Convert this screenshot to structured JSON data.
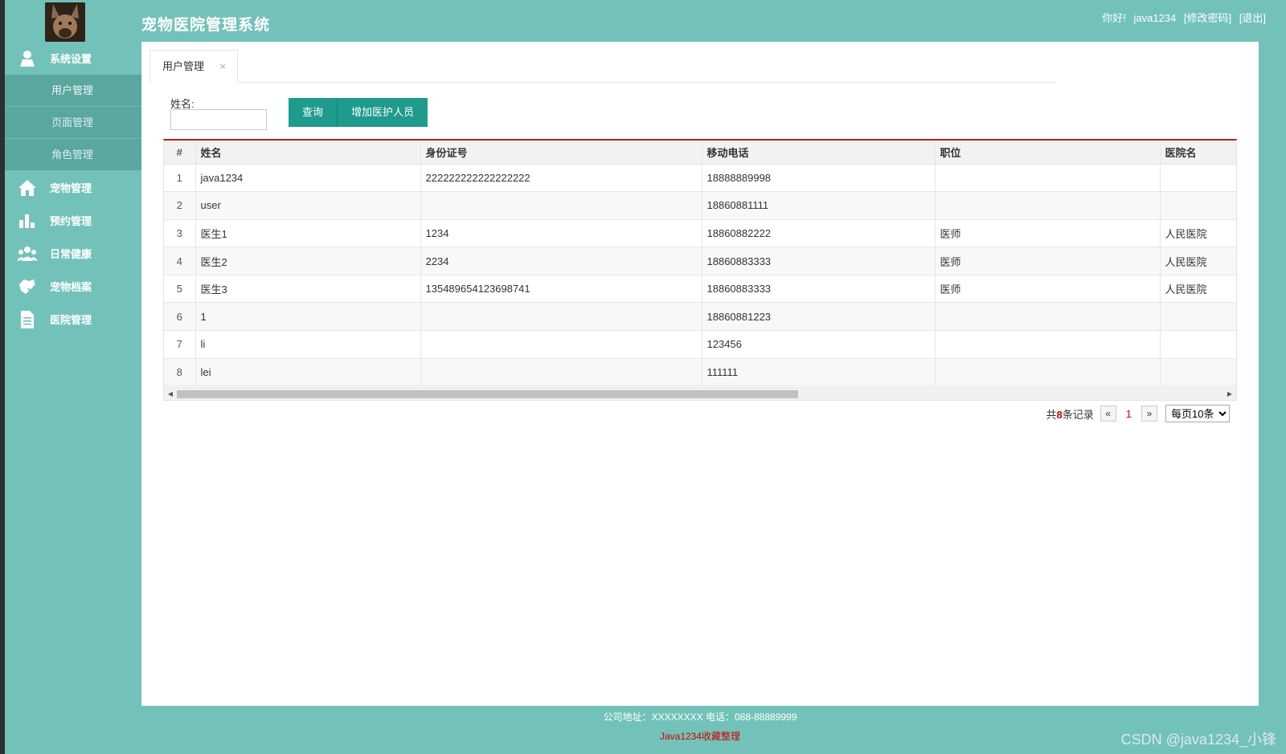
{
  "app": {
    "title": "宠物医院管理系统",
    "greeting": "你好!",
    "username": "java1234",
    "change_password": "[修改密码]",
    "logout": "[退出]"
  },
  "sidebar": {
    "sections": [
      {
        "label": "系统设置",
        "icon": "user-icon"
      },
      {
        "label": "宠物管理",
        "icon": "home-icon"
      },
      {
        "label": "预约管理",
        "icon": "bar-chart-icon"
      },
      {
        "label": "日常健康",
        "icon": "group-icon"
      },
      {
        "label": "宠物档案",
        "icon": "pet-record-icon"
      },
      {
        "label": "医院管理",
        "icon": "document-icon"
      }
    ],
    "sub_items": [
      "用户管理",
      "页面管理",
      "角色管理"
    ]
  },
  "tabs": [
    {
      "label": "用户管理",
      "close": "×"
    }
  ],
  "search": {
    "label": "姓名:",
    "value": "",
    "placeholder": ""
  },
  "buttons": {
    "query": "查询",
    "add": "增加医护人员"
  },
  "table": {
    "headers": [
      "#",
      "姓名",
      "身份证号",
      "移动电话",
      "职位",
      "医院名"
    ],
    "rows": [
      [
        "1",
        "java1234",
        "222222222222222222",
        "18888889998",
        "",
        ""
      ],
      [
        "2",
        "user",
        "",
        "18860881111",
        "",
        ""
      ],
      [
        "3",
        "医生1",
        "1234",
        "18860882222",
        "医师",
        "人民医院"
      ],
      [
        "4",
        "医生2",
        "2234",
        "18860883333",
        "医师",
        "人民医院"
      ],
      [
        "5",
        "医生3",
        "135489654123698741",
        "18860883333",
        "医师",
        "人民医院"
      ],
      [
        "6",
        "1",
        "",
        "18860881223",
        "",
        ""
      ],
      [
        "7",
        "li",
        "",
        "123456",
        "",
        ""
      ],
      [
        "8",
        "lei",
        "",
        "111111",
        "",
        ""
      ]
    ]
  },
  "pager": {
    "prefix": "共",
    "count": "8",
    "suffix": "条记录",
    "prev": "«",
    "current": "1",
    "next": "»",
    "page_size": "每页10条"
  },
  "footer": {
    "address": "公司地址：XXXXXXXX 电话：088-88889999",
    "credit": "Java1234收藏整理"
  },
  "watermark": "CSDN @java1234_小锋",
  "colors": {
    "header": "#73c2ba",
    "button": "#1e9b8d",
    "table_top_border": "#b22222"
  }
}
